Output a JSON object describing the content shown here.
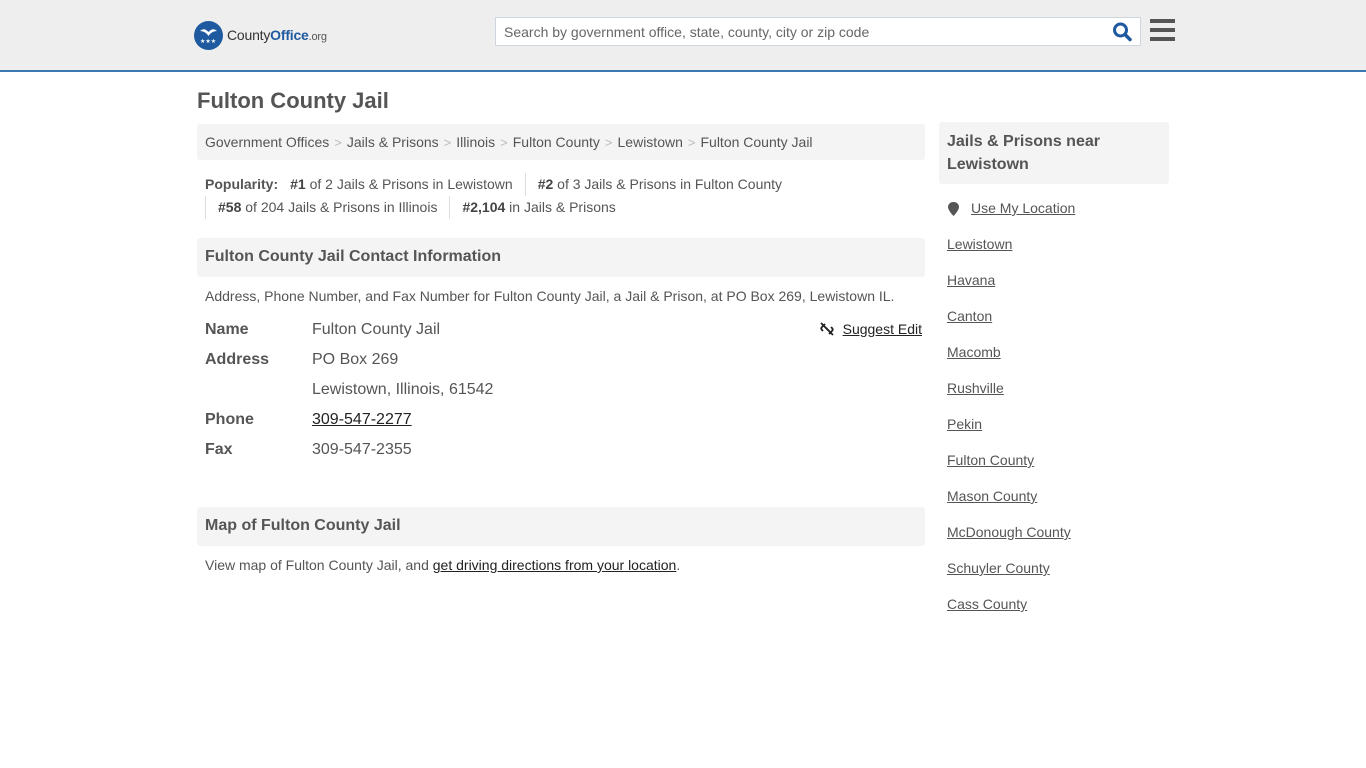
{
  "header": {
    "logo": {
      "county": "County",
      "office": "Office",
      "org": ".org"
    },
    "search": {
      "placeholder": "Search by government office, state, county, city or zip code",
      "value": ""
    },
    "colors": {
      "accent": "#3a78b3",
      "brand": "#1f5aa0"
    }
  },
  "page": {
    "title": "Fulton County Jail"
  },
  "breadcrumb": [
    "Government Offices",
    "Jails & Prisons",
    "Illinois",
    "Fulton County",
    "Lewistown",
    "Fulton County Jail"
  ],
  "popularity": {
    "label": "Popularity:",
    "items": [
      {
        "rank": "#1",
        "text": " of 2 Jails & Prisons in Lewistown"
      },
      {
        "rank": "#2",
        "text": " of 3 Jails & Prisons in Fulton County"
      },
      {
        "rank": "#58",
        "text": " of 204 Jails & Prisons in Illinois"
      },
      {
        "rank": "#2,104",
        "text": " in Jails & Prisons"
      }
    ]
  },
  "contact": {
    "heading": "Fulton County Jail Contact Information",
    "description": "Address, Phone Number, and Fax Number for Fulton County Jail, a Jail & Prison, at PO Box 269, Lewistown IL.",
    "suggest_edit": "Suggest Edit",
    "labels": {
      "name": "Name",
      "address": "Address",
      "phone": "Phone",
      "fax": "Fax"
    },
    "name": "Fulton County Jail",
    "address_line1": "PO Box 269",
    "address_line2": "Lewistown, Illinois, 61542",
    "phone": "309-547-2277",
    "fax": "309-547-2355"
  },
  "map": {
    "heading": "Map of Fulton County Jail",
    "text_before": "View map of Fulton County Jail, and ",
    "link": "get driving directions from your location",
    "text_after": "."
  },
  "sidebar": {
    "heading": "Jails & Prisons near Lewistown",
    "use_location": "Use My Location",
    "items": [
      "Lewistown",
      "Havana",
      "Canton",
      "Macomb",
      "Rushville",
      "Pekin",
      "Fulton County",
      "Mason County",
      "McDonough County",
      "Schuyler County",
      "Cass County"
    ]
  }
}
